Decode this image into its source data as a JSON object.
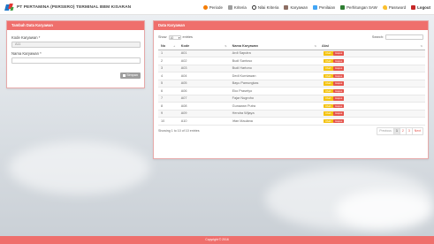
{
  "brand": {
    "title": "PT PERTAMINA (PERSERO) TERMINAL BBM KISARAN"
  },
  "nav": [
    {
      "label": "Periode",
      "icon": "calendar-icon"
    },
    {
      "label": "Kriteria",
      "icon": "list-icon"
    },
    {
      "label": "Nilai Kriteria",
      "icon": "circle-icon"
    },
    {
      "label": "Karyawan",
      "icon": "users-icon"
    },
    {
      "label": "Penilaian",
      "icon": "edit-icon"
    },
    {
      "label": "Perhitungan SAW",
      "icon": "table-icon"
    },
    {
      "label": "Password",
      "icon": "key-icon"
    },
    {
      "label": "Logout",
      "icon": "logout-icon"
    }
  ],
  "form": {
    "title": "Tambah Data Karyawan",
    "kode_label": "Kode Karyawan *",
    "kode_value": "A11",
    "nama_label": "Nama Karyawan *",
    "nama_value": "",
    "save_label": "Simpan"
  },
  "table": {
    "title": "Data Karyawan",
    "show_label": "Show",
    "entries_value": "10",
    "entries_label": "entries",
    "search_label": "Search:",
    "columns": [
      "No",
      "Kode",
      "Nama Karyawan",
      "Aksi"
    ],
    "edit_label": "Ubah",
    "delete_label": "Hapus",
    "rows": [
      {
        "no": "1",
        "kode": "A01",
        "nama": "Ardi Saputra"
      },
      {
        "no": "2",
        "kode": "A02",
        "nama": "Budi Santoso"
      },
      {
        "no": "3",
        "kode": "A03",
        "nama": "Budi Hartono"
      },
      {
        "no": "4",
        "kode": "A04",
        "nama": "Dedi Kurniawan"
      },
      {
        "no": "5",
        "kode": "A05",
        "nama": "Bayu Pamungkas"
      },
      {
        "no": "6",
        "kode": "A06",
        "nama": "Eko Prasetyo"
      },
      {
        "no": "7",
        "kode": "A07",
        "nama": "Fajar Nugroho"
      },
      {
        "no": "8",
        "kode": "A08",
        "nama": "Gunawan Putra"
      },
      {
        "no": "9",
        "kode": "A09",
        "nama": "Hendra Wijaya"
      },
      {
        "no": "10",
        "kode": "A10",
        "nama": "Irfan Maulana"
      }
    ],
    "info": "Showing 1 to 10 of 10 entries",
    "pagination": [
      "Previous",
      "1",
      "2",
      "3",
      "Next"
    ]
  },
  "footer": {
    "copyright": "Copyright © 2016"
  },
  "colors": {
    "accent": "#ef6f6c",
    "edit": "#f4c20d",
    "delete": "#e5534b"
  }
}
